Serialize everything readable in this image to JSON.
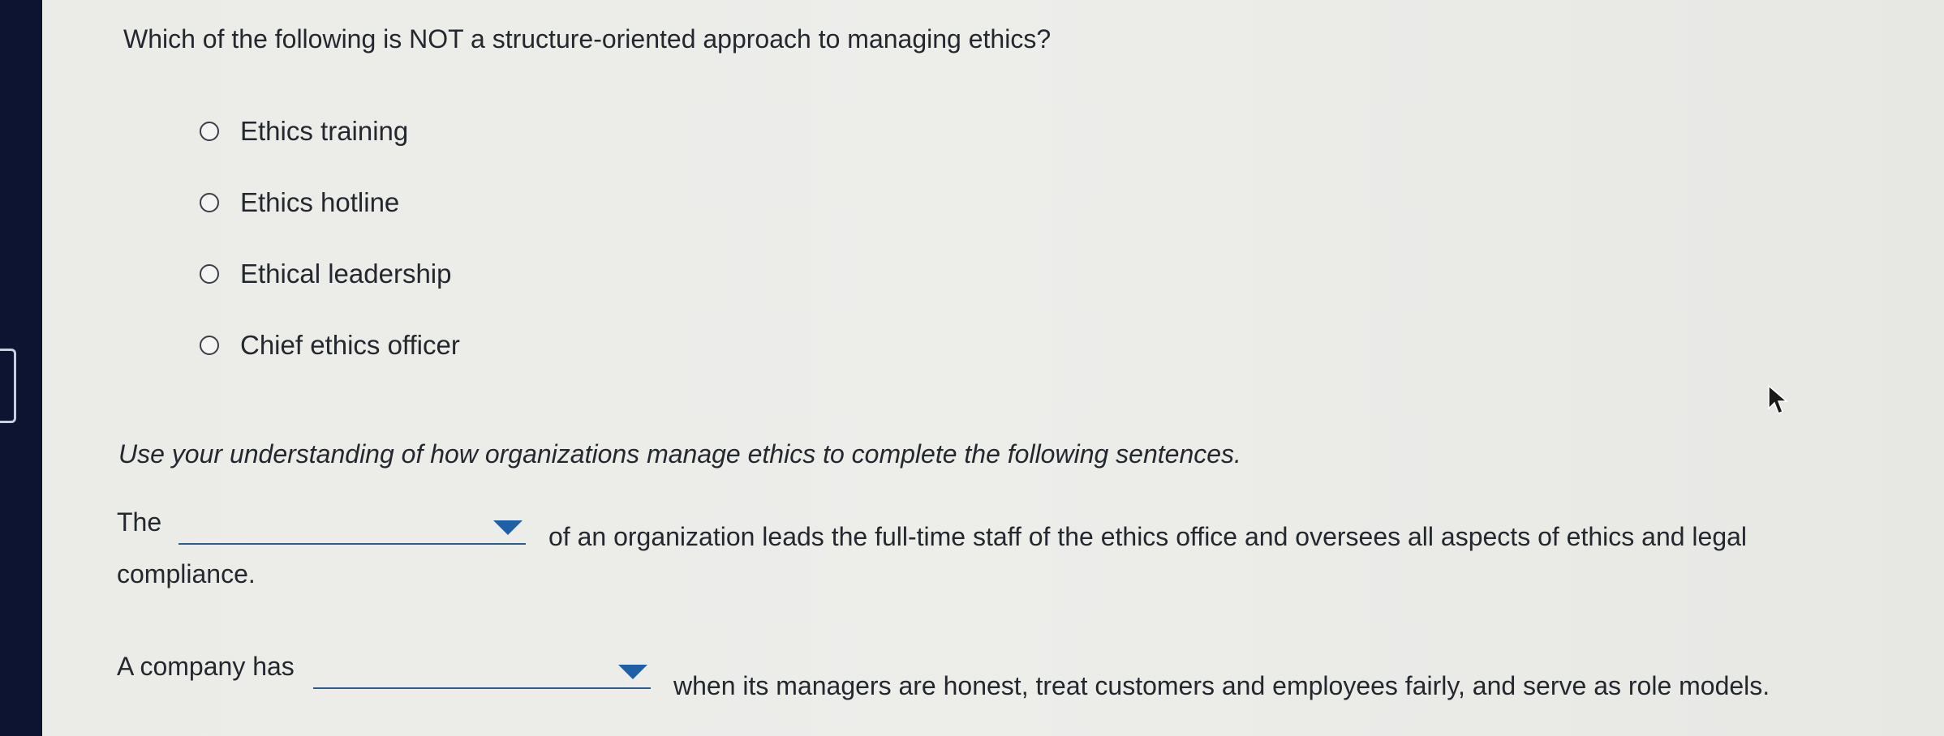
{
  "question": {
    "text": "Which of the following is NOT a structure-oriented approach to managing ethics?",
    "options": [
      {
        "label": "Ethics training"
      },
      {
        "label": "Ethics hotline"
      },
      {
        "label": "Ethical leadership"
      },
      {
        "label": "Chief ethics officer"
      }
    ]
  },
  "fill_in": {
    "instructions": "Use your understanding of how organizations manage ethics to complete the following sentences.",
    "sentence1": {
      "before": "The",
      "after": "of an organization leads the full-time staff of the ethics office and oversees all aspects of ethics and legal",
      "continuation": "compliance.",
      "selected": ""
    },
    "sentence2": {
      "before": "A company has",
      "after": "when its managers are honest, treat customers and employees fairly, and serve as role models.",
      "selected": ""
    }
  },
  "colors": {
    "accent": "#1f5fa6",
    "sidebar": "#0c1432"
  },
  "icons": [
    "radio-button-icon",
    "dropdown-caret-icon",
    "mouse-cursor-icon"
  ]
}
